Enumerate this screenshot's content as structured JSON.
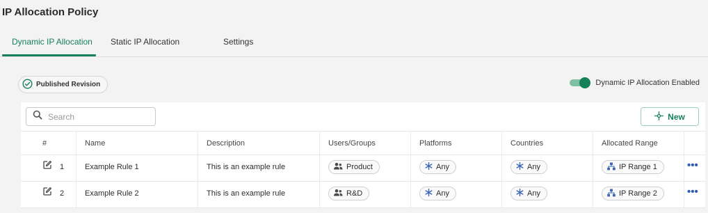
{
  "page": {
    "title": "IP Allocation Policy"
  },
  "tabs": [
    {
      "label": "Dynamic IP Allocation",
      "active": true
    },
    {
      "label": "Static IP Allocation",
      "active": false
    },
    {
      "label": "Settings",
      "active": false
    }
  ],
  "revision_badge": {
    "label": "Published Revision",
    "icon": "check-circle-icon"
  },
  "toggle": {
    "label": "Dynamic IP Allocation Enabled",
    "on": true
  },
  "search": {
    "placeholder": "Search",
    "value": ""
  },
  "new_button": {
    "label": "New",
    "icon": "crosshair-icon"
  },
  "table": {
    "columns": [
      "#",
      "Name",
      "Description",
      "Users/Groups",
      "Platforms",
      "Countries",
      "Allocated Range"
    ],
    "rows": [
      {
        "num": "1",
        "name": "Example Rule 1",
        "description": "This is an example rule",
        "users": "Product",
        "platforms": "Any",
        "countries": "Any",
        "range": "IP Range 1"
      },
      {
        "num": "2",
        "name": "Example Rule 2",
        "description": "This is an example rule",
        "users": "R&D",
        "platforms": "Any",
        "countries": "Any",
        "range": "IP Range 2"
      }
    ]
  },
  "colors": {
    "accent": "#15805a",
    "more_menu": "#2f5db3",
    "background": "#f3f3f3"
  }
}
